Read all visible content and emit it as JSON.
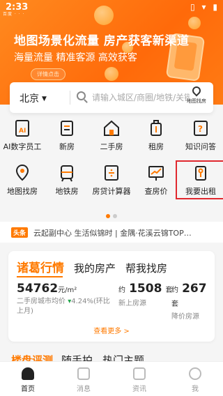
{
  "status_bar": {
    "time": "2:33",
    "left_icons": "百度 ·  ·  ·",
    "right": [
      "▯",
      "▾",
      "▮"
    ]
  },
  "banner": {
    "title": "地图场景化流量 房产获客新渠道",
    "subtitle": "海量流量  精准客源  高效获客",
    "button": "详情点击",
    "colors": {
      "start": "#ff8a1f",
      "end": "#ff6a0a"
    }
  },
  "search": {
    "city": "北京",
    "placeholder": "请输入城区/商圈/地铁/关键词",
    "map_label": "地图找房"
  },
  "shortcuts_row1": [
    {
      "label": "AI数字员工",
      "icon": "ai-document-icon"
    },
    {
      "label": "新房",
      "icon": "new-house-icon"
    },
    {
      "label": "二手房",
      "icon": "house-icon"
    },
    {
      "label": "租房",
      "icon": "suitcase-icon"
    },
    {
      "label": "知识问答",
      "icon": "qa-icon"
    }
  ],
  "shortcuts_row2": [
    {
      "label": "地图找房",
      "icon": "map-pin-icon"
    },
    {
      "label": "地铁房",
      "icon": "subway-icon"
    },
    {
      "label": "房贷计算器",
      "icon": "calculator-icon"
    },
    {
      "label": "查房价",
      "icon": "trend-chart-icon"
    },
    {
      "label": "我要出租",
      "icon": "rent-out-icon"
    }
  ],
  "headline": {
    "tag": "头条",
    "text": "云起副中心 生活似锦时 | 金隅·花溪云锦TOP…"
  },
  "market": {
    "tabs": [
      "诸葛行情",
      "我的房产",
      "帮我找房"
    ],
    "price": {
      "value": "54762",
      "unit": "元/m²",
      "desc_prefix": "二手房城市均价",
      "change": "4.24%",
      "desc_suffix": "(环比上月)"
    },
    "new_listings": {
      "prefix": "约",
      "value": "1508",
      "unit": "套",
      "label": "新上房源"
    },
    "price_cut": {
      "prefix": "约",
      "value": "267",
      "unit": "套",
      "label": "降价房源"
    },
    "more": "查看更多 >"
  },
  "peek_tabs": [
    "楼盘评测",
    "随手拍",
    "热门主题"
  ],
  "tabbar": [
    {
      "label": "首页",
      "icon": "home-icon",
      "active": true
    },
    {
      "label": "消息",
      "icon": "message-icon",
      "active": false
    },
    {
      "label": "资讯",
      "icon": "news-icon",
      "active": false
    },
    {
      "label": "我",
      "icon": "profile-icon",
      "active": false
    }
  ],
  "accent": "#ff7a00",
  "highlight_color": "#e0282e"
}
